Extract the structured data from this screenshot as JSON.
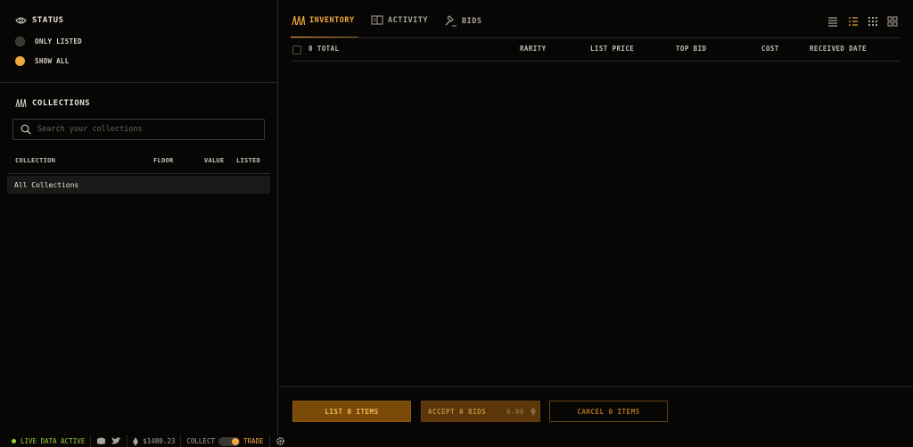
{
  "sidebar": {
    "status": {
      "title": "STATUS",
      "icon": "eye-icon",
      "options": [
        {
          "label": "ONLY LISTED",
          "selected": false
        },
        {
          "label": "SHOW ALL",
          "selected": true
        }
      ]
    },
    "collections": {
      "title": "COLLECTIONS",
      "icon": "collections-icon",
      "search_placeholder": "Search your collections",
      "columns": [
        "COLLECTION",
        "FLOOR",
        "VALUE",
        "LISTED"
      ],
      "rows": [
        {
          "name": "All Collections"
        }
      ]
    }
  },
  "main": {
    "tabs": [
      {
        "label": "INVENTORY",
        "icon": "collections-icon",
        "active": true
      },
      {
        "label": "ACTIVITY",
        "icon": "book-icon",
        "active": false
      },
      {
        "label": "BIDS",
        "icon": "gavel-icon",
        "active": false
      }
    ],
    "view_modes": [
      {
        "icon": "list-icon",
        "active": false
      },
      {
        "icon": "detailed-list-icon",
        "active": true
      },
      {
        "icon": "small-grid-icon",
        "active": false
      },
      {
        "icon": "large-grid-icon",
        "active": false
      }
    ],
    "table_columns": {
      "total": "0 TOTAL",
      "rarity": "RARITY",
      "list_price": "LIST PRICE",
      "top_bid": "TOP BID",
      "cost": "COST",
      "received_date": "RECEIVED DATE"
    },
    "actions": {
      "list": "LIST 0 ITEMS",
      "accept": "ACCEPT 0 BIDS",
      "accept_value": "0.00",
      "cancel": "CANCEL 0 ITEMS"
    }
  },
  "statusbar": {
    "live": "LIVE DATA ACTIVE",
    "eth_price": "$1480.23",
    "mode_left": "COLLECT",
    "mode_right": "TRADE"
  },
  "colors": {
    "accent": "#f2a93b",
    "live": "#9ad03a",
    "background": "#070605"
  }
}
